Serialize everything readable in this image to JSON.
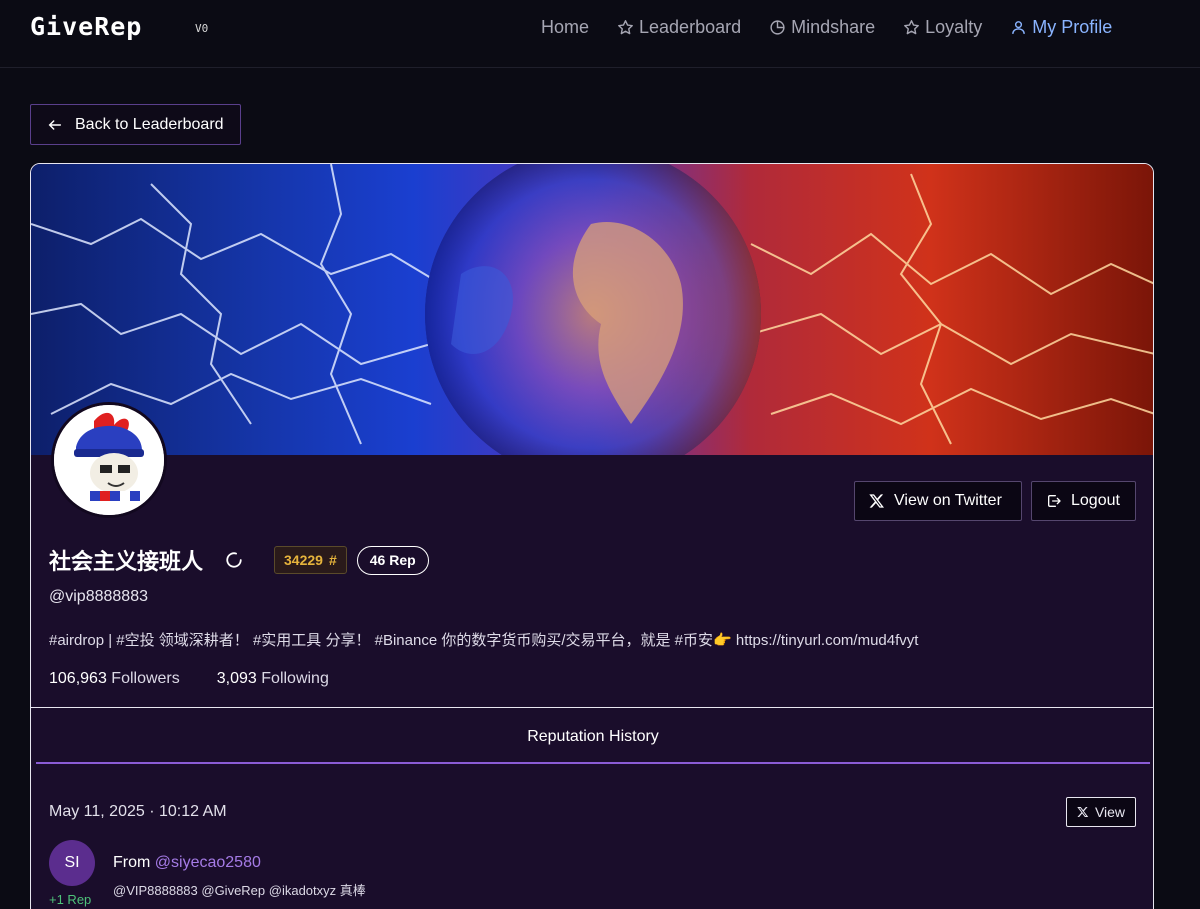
{
  "header": {
    "logo": "GiveRep",
    "version": "V0",
    "nav": [
      {
        "label": "Home",
        "icon": "none"
      },
      {
        "label": "Leaderboard",
        "icon": "star-icon"
      },
      {
        "label": "Mindshare",
        "icon": "pie-chart-icon"
      },
      {
        "label": "Loyalty",
        "icon": "star-icon"
      },
      {
        "label": "My Profile",
        "icon": "user-icon",
        "active": true
      }
    ]
  },
  "back_button": {
    "label": "Back to Leaderboard"
  },
  "profile": {
    "display_name": "社会主义接班人",
    "rank": "34229",
    "rank_symbol": "#",
    "rep": "46 Rep",
    "handle": "@vip8888883",
    "bio": "#airdrop | #空投 领域深耕者！ #实用工具 分享！ #Binance 你的数字货币购买/交易平台，就是 #币安👉 https://tinyurl.com/mud4fvyt",
    "followers_count": "106,963",
    "followers_label": "Followers",
    "following_count": "3,093",
    "following_label": "Following",
    "view_twitter_label": "View on Twitter",
    "logout_label": "Logout"
  },
  "tabs": {
    "reputation_history": "Reputation History"
  },
  "history": [
    {
      "date": "May 11, 2025 · 10:12 AM",
      "view_label": "View",
      "avatar_initials": "SI",
      "from_prefix": "From",
      "from_handle": "@siyecao2580",
      "text": "@VIP8888883 @GiveRep @ikadotxyz 真棒",
      "rep_change": "+1 Rep"
    }
  ],
  "colors": {
    "background": "#0b0b14",
    "card": "#1a0d2b",
    "accent_purple": "#8b5cd6",
    "nav_active": "#8ab4ff",
    "rank_gold": "#e6b43c",
    "rep_green": "#4ec27a"
  }
}
